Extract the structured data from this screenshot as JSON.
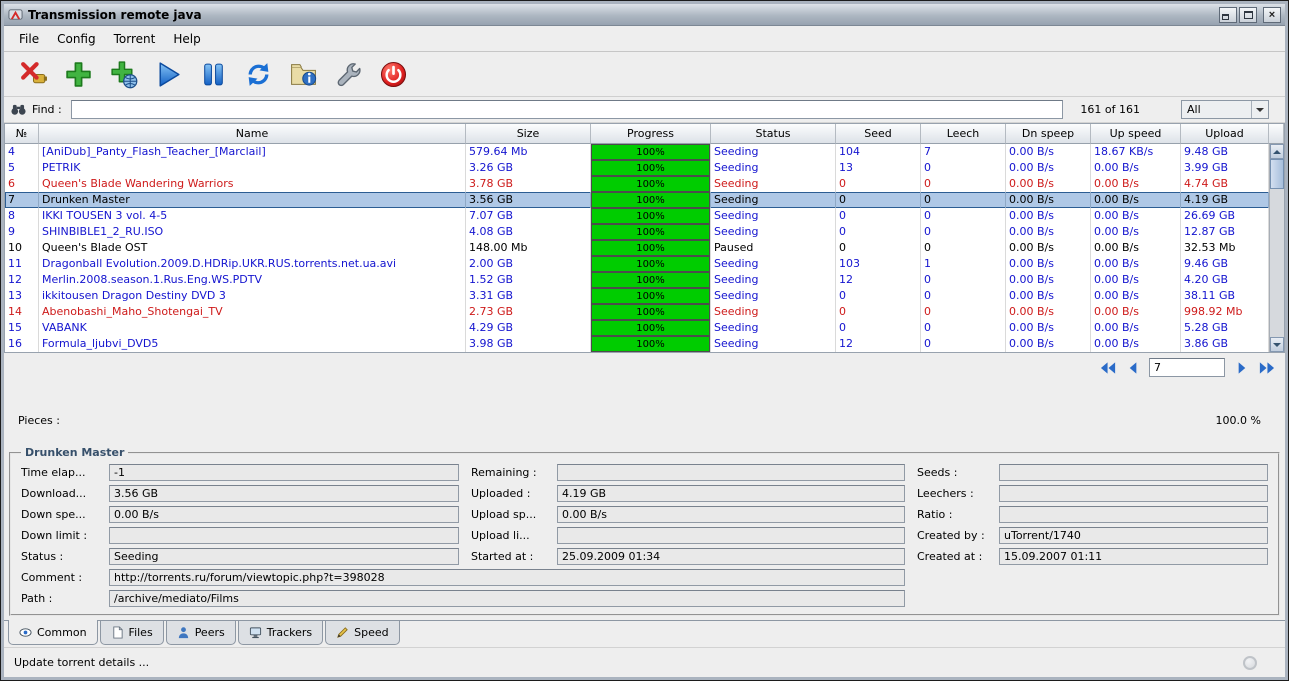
{
  "window": {
    "title": "Transmission remote java"
  },
  "menu": {
    "items": [
      "File",
      "Config",
      "Torrent",
      "Help"
    ]
  },
  "toolbar": {
    "buttons": [
      {
        "name": "disconnect",
        "icon": "disconnect-icon"
      },
      {
        "name": "add-torrent",
        "icon": "add-torrent-icon"
      },
      {
        "name": "add-torrent-url",
        "icon": "add-url-icon"
      },
      {
        "name": "start-torrent",
        "icon": "start-icon"
      },
      {
        "name": "pause-torrent",
        "icon": "pause-icon"
      },
      {
        "name": "refresh",
        "icon": "refresh-icon"
      },
      {
        "name": "torrent-info",
        "icon": "info-icon"
      },
      {
        "name": "settings",
        "icon": "settings-icon"
      },
      {
        "name": "quit",
        "icon": "quit-icon"
      }
    ]
  },
  "find": {
    "label": "Find :",
    "value": "",
    "count": "161 of 161",
    "filter": "All"
  },
  "table": {
    "columns": [
      "№",
      "Name",
      "Size",
      "Progress",
      "Status",
      "Seed",
      "Leech",
      "Dn speep",
      "Up speed",
      "Upload"
    ],
    "rows": [
      {
        "no": "4",
        "name": "[AniDub]_Panty_Flash_Teacher_[Marclail]",
        "size": "579.64 Mb",
        "progress": "100%",
        "status": "Seeding",
        "seed": "104",
        "leech": "7",
        "dn": "0.00 B/s",
        "up": "18.67 KB/s",
        "upload": "9.48 GB",
        "color": "blue",
        "selected": false
      },
      {
        "no": "5",
        "name": "PETRIK",
        "size": "3.26 GB",
        "progress": "100%",
        "status": "Seeding",
        "seed": "13",
        "leech": "0",
        "dn": "0.00 B/s",
        "up": "0.00 B/s",
        "upload": "3.99 GB",
        "color": "blue",
        "selected": false
      },
      {
        "no": "6",
        "name": "Queen's Blade Wandering Warriors",
        "size": "3.78 GB",
        "progress": "100%",
        "status": "Seeding",
        "seed": "0",
        "leech": "0",
        "dn": "0.00 B/s",
        "up": "0.00 B/s",
        "upload": "4.74 GB",
        "color": "red",
        "selected": false
      },
      {
        "no": "7",
        "name": "Drunken Master",
        "size": "3.56 GB",
        "progress": "100%",
        "status": "Seeding",
        "seed": "0",
        "leech": "0",
        "dn": "0.00 B/s",
        "up": "0.00 B/s",
        "upload": "4.19 GB",
        "color": "black",
        "selected": true
      },
      {
        "no": "8",
        "name": "IKKI TOUSEN 3 vol. 4-5",
        "size": "7.07 GB",
        "progress": "100%",
        "status": "Seeding",
        "seed": "0",
        "leech": "0",
        "dn": "0.00 B/s",
        "up": "0.00 B/s",
        "upload": "26.69 GB",
        "color": "blue",
        "selected": false
      },
      {
        "no": "9",
        "name": "SHINBIBLE1_2_RU.ISO",
        "size": "4.08 GB",
        "progress": "100%",
        "status": "Seeding",
        "seed": "0",
        "leech": "0",
        "dn": "0.00 B/s",
        "up": "0.00 B/s",
        "upload": "12.87 GB",
        "color": "blue",
        "selected": false
      },
      {
        "no": "10",
        "name": "Queen's Blade OST",
        "size": "148.00 Mb",
        "progress": "100%",
        "status": "Paused",
        "seed": "0",
        "leech": "0",
        "dn": "0.00 B/s",
        "up": "0.00 B/s",
        "upload": "32.53 Mb",
        "color": "black",
        "selected": false
      },
      {
        "no": "11",
        "name": "Dragonball Evolution.2009.D.HDRip.UKR.RUS.torrents.net.ua.avi",
        "size": "2.00 GB",
        "progress": "100%",
        "status": "Seeding",
        "seed": "103",
        "leech": "1",
        "dn": "0.00 B/s",
        "up": "0.00 B/s",
        "upload": "9.46 GB",
        "color": "blue",
        "selected": false
      },
      {
        "no": "12",
        "name": "Merlin.2008.season.1.Rus.Eng.WS.PDTV",
        "size": "1.52 GB",
        "progress": "100%",
        "status": "Seeding",
        "seed": "12",
        "leech": "0",
        "dn": "0.00 B/s",
        "up": "0.00 B/s",
        "upload": "4.20 GB",
        "color": "blue",
        "selected": false
      },
      {
        "no": "13",
        "name": "ikkitousen Dragon Destiny DVD 3",
        "size": "3.31 GB",
        "progress": "100%",
        "status": "Seeding",
        "seed": "0",
        "leech": "0",
        "dn": "0.00 B/s",
        "up": "0.00 B/s",
        "upload": "38.11 GB",
        "color": "blue",
        "selected": false
      },
      {
        "no": "14",
        "name": "Abenobashi_Maho_Shotengai_TV",
        "size": "2.73 GB",
        "progress": "100%",
        "status": "Seeding",
        "seed": "0",
        "leech": "0",
        "dn": "0.00 B/s",
        "up": "0.00 B/s",
        "upload": "998.92 Mb",
        "color": "red",
        "selected": false
      },
      {
        "no": "15",
        "name": "VABANK",
        "size": "4.29 GB",
        "progress": "100%",
        "status": "Seeding",
        "seed": "0",
        "leech": "0",
        "dn": "0.00 B/s",
        "up": "0.00 B/s",
        "upload": "5.28 GB",
        "color": "blue",
        "selected": false
      },
      {
        "no": "16",
        "name": "Formula_ljubvi_DVD5",
        "size": "3.98 GB",
        "progress": "100%",
        "status": "Seeding",
        "seed": "12",
        "leech": "0",
        "dn": "0.00 B/s",
        "up": "0.00 B/s",
        "upload": "3.86 GB",
        "color": "blue",
        "selected": false
      }
    ]
  },
  "pagination": {
    "page": "7"
  },
  "pieces": {
    "label": "Pieces :",
    "value": "100.0 %"
  },
  "details": {
    "title": "Drunken Master",
    "col1": [
      {
        "name": "time-elapsed",
        "label": "Time elap...",
        "value": "-1"
      },
      {
        "name": "downloaded",
        "label": "Download...",
        "value": "3.56 GB"
      },
      {
        "name": "down-speed",
        "label": "Down spe...",
        "value": "0.00 B/s"
      },
      {
        "name": "down-limit",
        "label": "Down limit :",
        "value": ""
      },
      {
        "name": "status",
        "label": "Status :",
        "value": "Seeding"
      }
    ],
    "col2": [
      {
        "name": "remaining",
        "label": "Remaining :",
        "value": ""
      },
      {
        "name": "uploaded",
        "label": "Uploaded :",
        "value": "4.19 GB"
      },
      {
        "name": "upload-speed",
        "label": "Upload sp...",
        "value": "0.00 B/s"
      },
      {
        "name": "upload-limit",
        "label": "Upload li...",
        "value": ""
      },
      {
        "name": "started-at",
        "label": "Started at :",
        "value": "25.09.2009 01:34"
      }
    ],
    "col3": [
      {
        "name": "seeds",
        "label": "Seeds :",
        "value": ""
      },
      {
        "name": "leechers",
        "label": "Leechers :",
        "value": ""
      },
      {
        "name": "ratio",
        "label": "Ratio :",
        "value": ""
      },
      {
        "name": "created-by",
        "label": "Created by :",
        "value": "uTorrent/1740"
      },
      {
        "name": "created-at",
        "label": "Created at :",
        "value": "15.09.2007 01:11"
      }
    ],
    "wide": [
      {
        "name": "comment",
        "label": "Comment :",
        "value": "http://torrents.ru/forum/viewtopic.php?t=398028"
      },
      {
        "name": "path",
        "label": "Path :",
        "value": "/archive/mediato/Films"
      }
    ]
  },
  "tabs": [
    {
      "label": "Common",
      "name": "common",
      "icon": "common-icon",
      "active": true
    },
    {
      "label": "Files",
      "name": "files",
      "icon": "files-icon",
      "active": false
    },
    {
      "label": "Peers",
      "name": "peers",
      "icon": "peers-icon",
      "active": false
    },
    {
      "label": "Trackers",
      "name": "trackers",
      "icon": "trackers-icon",
      "active": false
    },
    {
      "label": "Speed",
      "name": "speed",
      "icon": "speed-icon",
      "active": false
    }
  ],
  "statusbar": {
    "text": "Update torrent details ..."
  },
  "colors": {
    "row_blue": "#1414CF",
    "row_red": "#CE1A1A",
    "selection_bg": "#AFC8E6",
    "progress_green": "#00CC00",
    "accent_blue": "#2A6BC8"
  }
}
